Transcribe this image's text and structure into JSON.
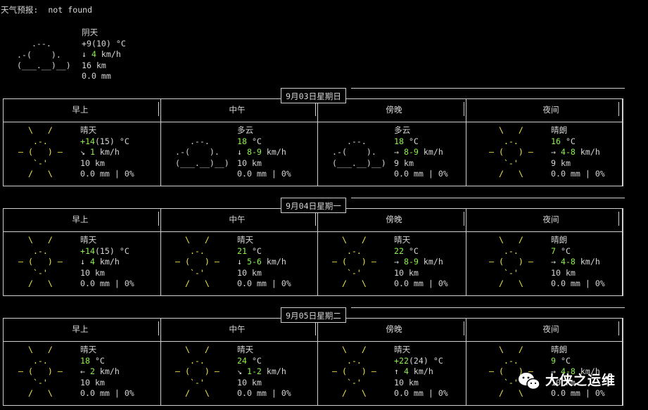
{
  "header": {
    "title": "天气预报:  not found"
  },
  "current": {
    "icon": "cloudy",
    "art": "   .--.\n.-(    ).\n(___.__)__)",
    "condition": "阴天",
    "temp": "+9(10) °C",
    "wind_arrow": "↓",
    "wind_speed": "4",
    "wind_unit": " km/h",
    "visibility": "16 km",
    "precip": "0.0 mm"
  },
  "periods": [
    "早上",
    "中午",
    "傍晚",
    "夜间"
  ],
  "days": [
    {
      "date": "9月03日星期日",
      "cells": [
        {
          "icon": "sun",
          "art": "  \\   /\n   .-.\n― (   ) ―\n   `-'\n  /   \\",
          "condition": "晴天",
          "temp_hi": "+14",
          "temp_paren": "(15)",
          "temp_unit": " °C",
          "wind_arrow": "↘",
          "wind": "1",
          "wind_unit": " km/h",
          "visibility": "10 km",
          "precip": "0.0 mm | 0%"
        },
        {
          "icon": "cloud",
          "art": "\n   .--.\n.-(    ).\n(___.__)__)\n",
          "condition": "多云",
          "temp_hi": "18",
          "temp_paren": "",
          "temp_unit": " °C",
          "wind_arrow": "↓",
          "wind": "8-9",
          "wind_unit": " km/h",
          "visibility": "10 km",
          "precip": "0.0 mm | 0%"
        },
        {
          "icon": "cloud",
          "art": "\n   .--.\n.-(    ).\n(___.__)__)\n",
          "condition": "多云",
          "temp_hi": "18",
          "temp_paren": "",
          "temp_unit": " °C",
          "wind_arrow": "→",
          "wind": "8-9",
          "wind_unit": " km/h",
          "visibility": "9 km",
          "precip": "0.0 mm | 0%"
        },
        {
          "icon": "sun",
          "art": "  \\   /\n   .-.\n― (   ) ―\n   `-'\n  /   \\",
          "condition": "晴朗",
          "temp_hi": "16",
          "temp_paren": "",
          "temp_unit": " °C",
          "wind_arrow": "→",
          "wind": "4-8",
          "wind_unit": " km/h",
          "visibility": "9 km",
          "precip": "0.0 mm | 0%"
        }
      ]
    },
    {
      "date": "9月04日星期一",
      "cells": [
        {
          "icon": "sun",
          "art": "  \\   /\n   .-.\n― (   ) ―\n   `-'\n  /   \\",
          "condition": "晴天",
          "temp_hi": "+14",
          "temp_paren": "(15)",
          "temp_unit": " °C",
          "wind_arrow": "↓",
          "wind": "4",
          "wind_unit": " km/h",
          "visibility": "10 km",
          "precip": "0.0 mm | 0%"
        },
        {
          "icon": "sun",
          "art": "  \\   /\n   .-.\n― (   ) ―\n   `-'\n  /   \\",
          "condition": "晴天",
          "temp_hi": "21",
          "temp_paren": "",
          "temp_unit": " °C",
          "wind_arrow": "↓",
          "wind": "5-6",
          "wind_unit": " km/h",
          "visibility": "10 km",
          "precip": "0.0 mm | 0%"
        },
        {
          "icon": "sun",
          "art": "  \\   /\n   .-.\n― (   ) ―\n   `-'\n  /   \\",
          "condition": "晴天",
          "temp_hi": "22",
          "temp_paren": "",
          "temp_unit": " °C",
          "wind_arrow": "→",
          "wind": "8-9",
          "wind_unit": " km/h",
          "visibility": "10 km",
          "precip": "0.0 mm | 0%"
        },
        {
          "icon": "sun",
          "art": "  \\   /\n   .-.\n― (   ) ―\n   `-'\n  /   \\",
          "condition": "晴朗",
          "temp_hi": "7",
          "temp_paren": "",
          "temp_unit": " °C",
          "wind_arrow": "→",
          "wind": "4-8",
          "wind_unit": " km/h",
          "visibility": "10 km",
          "precip": "0.0 mm | 0%"
        }
      ]
    },
    {
      "date": "9月05日星期二",
      "cells": [
        {
          "icon": "sun",
          "art": "  \\   /\n   .-.\n― (   ) ―\n   `-'\n  /   \\",
          "condition": "晴天",
          "temp_hi": "18",
          "temp_paren": "",
          "temp_unit": " °C",
          "wind_arrow": "←",
          "wind": "2",
          "wind_unit": " km/h",
          "visibility": "10 km",
          "precip": "0.0 mm | 0%"
        },
        {
          "icon": "sun",
          "art": "  \\   /\n   .-.\n― (   ) ―\n   `-'\n  /   \\",
          "condition": "晴天",
          "temp_hi": "24",
          "temp_paren": "",
          "temp_unit": " °C",
          "wind_arrow": "↘",
          "wind": "1-2",
          "wind_unit": " km/h",
          "visibility": "10 km",
          "precip": "0.0 mm | 0%"
        },
        {
          "icon": "sun",
          "art": "  \\   /\n   .-.\n― (   ) ―\n   `-'\n  /   \\",
          "condition": "晴天",
          "temp_hi": "+22",
          "temp_paren": "(24)",
          "temp_unit": " °C",
          "wind_arrow": "↑",
          "wind": "4",
          "wind_unit": " km/h",
          "visibility": "10 km",
          "precip": "0.0 mm | 0%"
        },
        {
          "icon": "sun",
          "art": "  \\   /\n   .-.\n― (   ) ―\n   `-'\n  /   \\",
          "condition": "晴朗",
          "temp_hi": "9",
          "temp_paren": "",
          "temp_unit": " °C",
          "wind_arrow": "→",
          "wind": "4-8",
          "wind_unit": " km/h",
          "visibility": "10 km",
          "precip": "0.0 mm | 0%"
        }
      ]
    }
  ],
  "watermark": {
    "icon": "wechat-icon",
    "text": "大侠之运维"
  },
  "colors": {
    "background": "#000000",
    "text": "#d6d6d6",
    "sun": "#f2e94e",
    "value_green": "#8df04a"
  }
}
